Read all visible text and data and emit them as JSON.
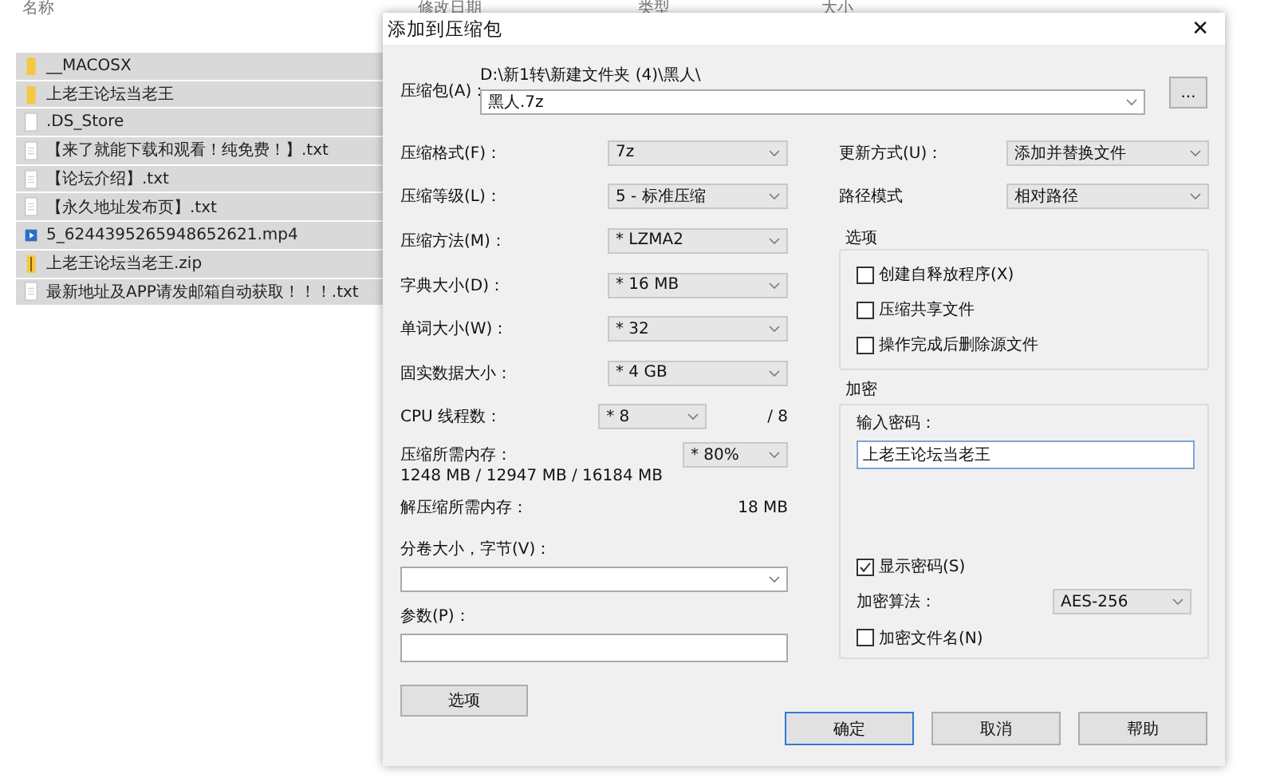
{
  "explorer": {
    "columns": [
      "名称",
      "修改日期",
      "类型",
      "大小"
    ],
    "files": [
      {
        "name": "__MACOSX",
        "kind": "folder",
        "selected": true
      },
      {
        "name": "上老王论坛当老王",
        "kind": "folder",
        "selected": true
      },
      {
        "name": ".DS_Store",
        "kind": "file",
        "selected": true
      },
      {
        "name": "【来了就能下载和观看！纯免费！】.txt",
        "kind": "text",
        "selected": true
      },
      {
        "name": "【论坛介绍】.txt",
        "kind": "text",
        "selected": true
      },
      {
        "name": "【永久地址发布页】.txt",
        "kind": "text",
        "selected": true
      },
      {
        "name": "5_6244395265948652621.mp4",
        "kind": "video",
        "selected": true
      },
      {
        "name": "上老王论坛当老王.zip",
        "kind": "zip",
        "selected": true
      },
      {
        "name": "最新地址及APP请发邮箱自动获取！！！.txt",
        "kind": "text",
        "selected": true
      }
    ]
  },
  "dialog": {
    "title": "添加到压缩包",
    "close": "✕",
    "archive": {
      "label": "压缩包(A)：",
      "path": "D:\\新1转\\新建文件夹 (4)\\黑人\\",
      "value": "黑人.7z",
      "browse": "..."
    },
    "settings": [
      {
        "label": "压缩格式(F)：",
        "value": "7z"
      },
      {
        "label": "压缩等级(L)：",
        "value": "5 - 标准压缩"
      },
      {
        "label": "压缩方法(M)：",
        "value": "* LZMA2"
      },
      {
        "label": "字典大小(D)：",
        "value": "* 16 MB"
      },
      {
        "label": "单词大小(W)：",
        "value": "* 32"
      },
      {
        "label": "固实数据大小：",
        "value": "* 4 GB"
      }
    ],
    "cpu": {
      "label": "CPU 线程数：",
      "value": "* 8",
      "max": "/ 8"
    },
    "memory": {
      "label": "压缩所需内存：",
      "reading": "1248 MB / 12947 MB / 16184 MB",
      "value": "* 80%"
    },
    "decompress_memory": {
      "label": "解压缩所需内存：",
      "reading": "18 MB"
    },
    "volume": {
      "label": "分卷大小，字节(V)："
    },
    "params": {
      "label": "参数(P)："
    },
    "options_button": "选项",
    "update": {
      "label": "更新方式(U)：",
      "value": "添加并替换文件"
    },
    "path_mode": {
      "label": "路径模式",
      "value": "相对路径"
    },
    "options": {
      "title": "选项",
      "items": [
        {
          "label": "创建自释放程序(X)",
          "checked": false
        },
        {
          "label": "压缩共享文件",
          "checked": false
        },
        {
          "label": "操作完成后删除源文件",
          "checked": false
        }
      ]
    },
    "encryption": {
      "title": "加密",
      "password_label": "输入密码：",
      "password": "上老王论坛当老王",
      "show_password": {
        "label": "显示密码(S)",
        "checked": true
      },
      "method_label": "加密算法：",
      "method": "AES-256",
      "encrypt_names": {
        "label": "加密文件名(N)",
        "checked": false
      }
    },
    "buttons": [
      {
        "label": "确定",
        "default": true
      },
      {
        "label": "取消",
        "default": false
      },
      {
        "label": "帮助",
        "default": false
      }
    ]
  }
}
